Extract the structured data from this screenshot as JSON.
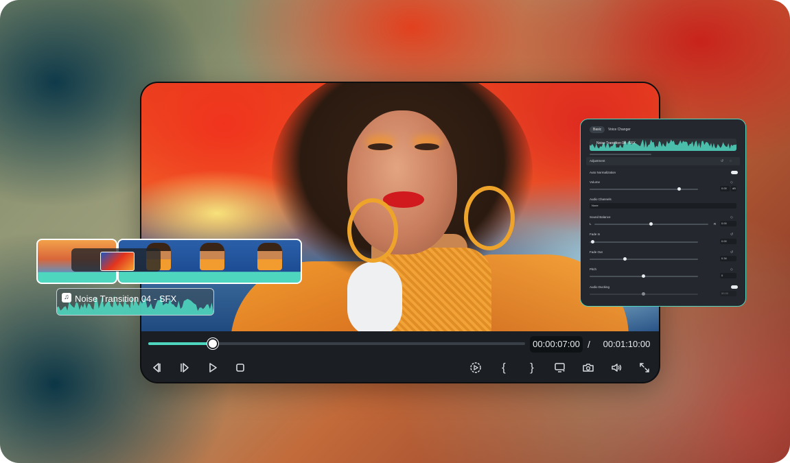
{
  "player": {
    "current_time": "00:00:07:00",
    "separator": "/",
    "total_time": "00:01:10:00",
    "progress": 0.17,
    "controls": [
      {
        "name": "prev-frame-icon",
        "glyph": "◁|"
      },
      {
        "name": "step-forward-icon",
        "glyph": "|▷"
      },
      {
        "name": "play-icon",
        "glyph": "▷"
      },
      {
        "name": "stop-icon",
        "glyph": "□"
      },
      {
        "name": "render-preview-icon",
        "glyph": "⦿"
      },
      {
        "name": "mark-in-icon",
        "glyph": "{"
      },
      {
        "name": "mark-out-icon",
        "glyph": "}"
      },
      {
        "name": "display-settings-icon",
        "glyph": "▭"
      },
      {
        "name": "snapshot-icon",
        "glyph": "📷"
      },
      {
        "name": "volume-icon",
        "glyph": "🔈"
      },
      {
        "name": "fullscreen-icon",
        "glyph": "⤢"
      }
    ]
  },
  "timeline": {
    "audio_clip_label": "Noise Transition 04 - SFX"
  },
  "panel": {
    "tabs": [
      "Basic",
      "Voice Changer"
    ],
    "active_tab": "Basic",
    "clip_name": "Noise Transition 04 - SFX",
    "section_title": "Adjustment",
    "auto_normalization_label": "Auto Normalization",
    "volume_label": "Volume",
    "volume_value": "0.00",
    "volume_unit": "dB",
    "volume_level": 0.83,
    "audio_channels_label": "Audio Channels",
    "audio_channels_value": "None",
    "sound_balance_label": "Sound Balance",
    "balance_left": "L",
    "balance_right": "R",
    "balance_value": "0.00",
    "balance_level": 0.5,
    "fade_in_label": "Fade In",
    "fade_in_value": "0.00",
    "fade_in_level": 0.03,
    "fade_out_label": "Fade Out",
    "fade_out_value": "0.34",
    "fade_out_level": 0.33,
    "pitch_label": "Pitch",
    "pitch_value": "0",
    "pitch_level": 0.5,
    "audio_ducking_label": "Audio Ducking",
    "audio_ducking_value": "50.00",
    "audio_ducking_level": 0.5
  },
  "colors": {
    "accent": "#4fd6bf",
    "panel_bg": "#24282e",
    "player_bg": "#1b1f24"
  }
}
